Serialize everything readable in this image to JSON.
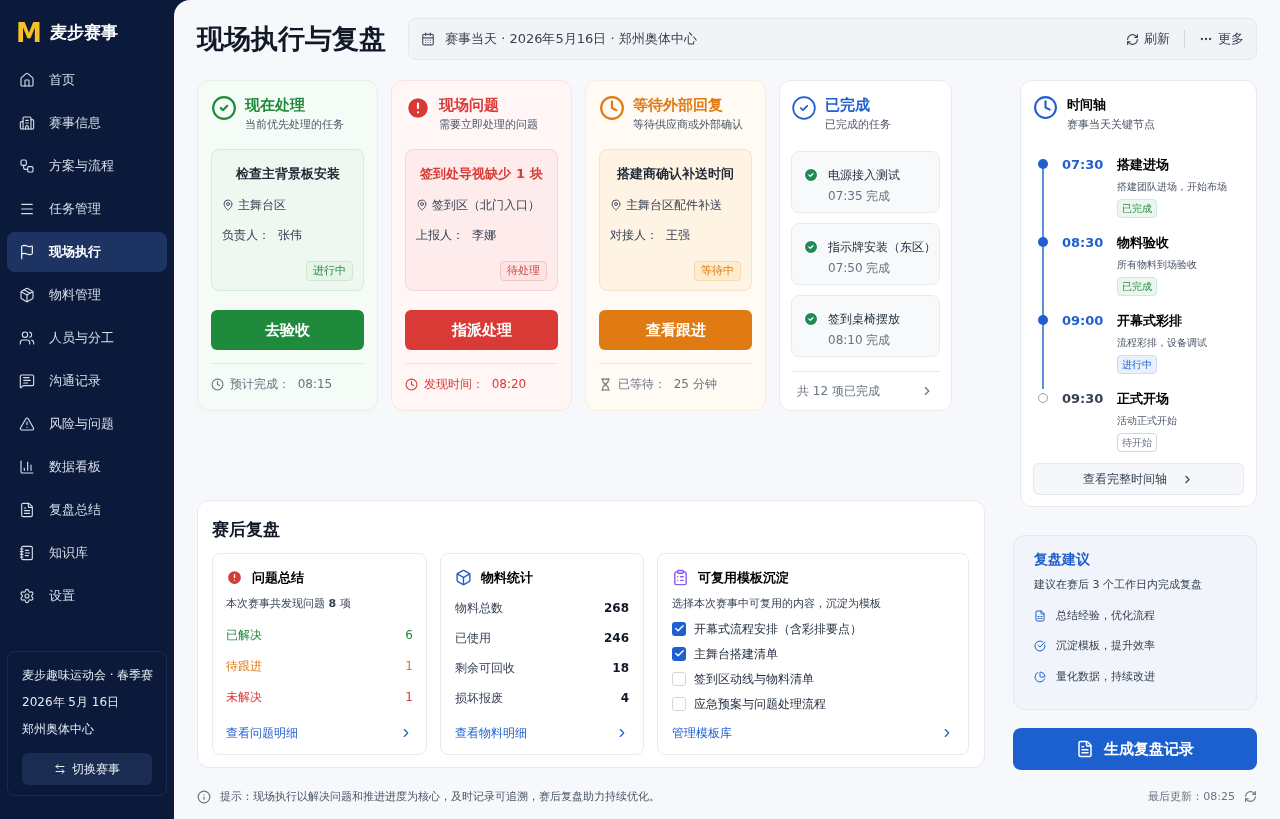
{
  "brand": {
    "logo": "M",
    "name": "麦步赛事"
  },
  "nav": [
    {
      "label": "首页",
      "selected": false
    },
    {
      "label": "赛事信息",
      "selected": false
    },
    {
      "label": "方案与流程",
      "selected": false
    },
    {
      "label": "任务管理",
      "selected": false
    },
    {
      "label": "现场执行",
      "selected": true
    },
    {
      "label": "物料管理",
      "selected": false
    },
    {
      "label": "人员与分工",
      "selected": false
    },
    {
      "label": "沟通记录",
      "selected": false
    },
    {
      "label": "风险与问题",
      "selected": false
    },
    {
      "label": "数据看板",
      "selected": false
    },
    {
      "label": "复盘总结",
      "selected": false
    },
    {
      "label": "知识库",
      "selected": false
    },
    {
      "label": "设置",
      "selected": false
    }
  ],
  "event": {
    "name": "麦步趣味运动会 · 春季赛",
    "date": "2026年 5月 16日",
    "venue": "郑州奥体中心",
    "switch_button": "切换赛事"
  },
  "header": {
    "title": "现场执行与复盘",
    "info": "赛事当天 · 2026年5月16日 · 郑州奥体中心",
    "refresh": "刷新",
    "more": "更多"
  },
  "columns": [
    {
      "kind": "now",
      "title": "现在处理",
      "subtitle": "当前优先处理的任务",
      "task": {
        "title": "检查主背景板安装",
        "location": "主舞台区",
        "person": "负责人：  张伟",
        "badge": "进行中"
      },
      "button": "去验收",
      "footer": "预计完成：  08:15"
    },
    {
      "kind": "issue",
      "title": "现场问题",
      "subtitle": "需要立即处理的问题",
      "task": {
        "title": "签到处导视缺少 1 块",
        "location": "签到区（北门入口）",
        "person": "上报人：  李娜",
        "badge": "待处理"
      },
      "button": "指派处理",
      "footer": "发现时间：  08:20"
    },
    {
      "kind": "waiting",
      "title": "等待外部回复",
      "subtitle": "等待供应商或外部确认",
      "task": {
        "title": "搭建商确认补送时间",
        "location": "主舞台区配件补送",
        "person": "对接人：  王强",
        "badge": "等待中"
      },
      "button": "查看跟进",
      "footer": "已等待：  25 分钟"
    },
    {
      "kind": "completed",
      "title": "已完成",
      "subtitle": "已完成的任务",
      "items": [
        {
          "title": "电源接入测试",
          "time": "07:35 完成"
        },
        {
          "title": "指示牌安装（东区）",
          "time": "07:50 完成"
        },
        {
          "title": "签到桌椅摆放",
          "time": "08:10 完成"
        }
      ],
      "footer": "共 12 项已完成"
    }
  ],
  "timeline": {
    "title": "时间轴",
    "subtitle": "赛事当天关键节点",
    "items": [
      {
        "time": "07:30",
        "title": "搭建进场",
        "desc": "搭建团队进场，开始布场",
        "status": "已完成",
        "kind": "done"
      },
      {
        "time": "08:30",
        "title": "物料验收",
        "desc": "所有物料到场验收",
        "status": "已完成",
        "kind": "done"
      },
      {
        "time": "09:00",
        "title": "开幕式彩排",
        "desc": "流程彩排，设备调试",
        "status": "进行中",
        "kind": "active"
      },
      {
        "time": "09:30",
        "title": "正式开场",
        "desc": "活动正式开始",
        "status": "待开始",
        "kind": "pending"
      }
    ],
    "link": "查看完整时间轴"
  },
  "review": {
    "title": "赛后复盘",
    "issues": {
      "title": "问题总结",
      "summary": "本次赛事共发现问题 **8** 项",
      "rows": [
        {
          "label": "已解决",
          "value": "6",
          "kind": "resolved"
        },
        {
          "label": "待跟进",
          "value": "1",
          "kind": "following"
        },
        {
          "label": "未解决",
          "value": "1",
          "kind": "unresolved"
        }
      ],
      "link": "查看问题明细"
    },
    "materials": {
      "title": "物料统计",
      "rows": [
        {
          "label": "物料总数",
          "value": "268"
        },
        {
          "label": "已使用",
          "value": "246"
        },
        {
          "label": "剩余可回收",
          "value": "18"
        },
        {
          "label": "损坏报废",
          "value": "4"
        }
      ],
      "link": "查看物料明细"
    },
    "templates": {
      "title": "可复用模板沉淀",
      "desc": "选择本次赛事中可复用的内容，沉淀为模板",
      "items": [
        {
          "label": "开幕式流程安排（含彩排要点）",
          "checked": true
        },
        {
          "label": "主舞台搭建清单",
          "checked": true
        },
        {
          "label": "签到区动线与物料清单",
          "checked": false
        },
        {
          "label": "应急预案与问题处理流程",
          "checked": false
        }
      ],
      "link": "管理模板库"
    }
  },
  "suggestions": {
    "title": "复盘建议",
    "subtitle": "建议在赛后 3 个工作日内完成复盘",
    "items": [
      "总结经验，优化流程",
      "沉淀模板，提升效率",
      "量化数据，持续改进"
    ]
  },
  "generate_button": "生成复盘记录",
  "footer": {
    "tip": "提示：现场执行以解决问题和推进进度为核心，及时记录可追溯，赛后复盘助力持续优化。",
    "updated": "最后更新：08:25"
  }
}
